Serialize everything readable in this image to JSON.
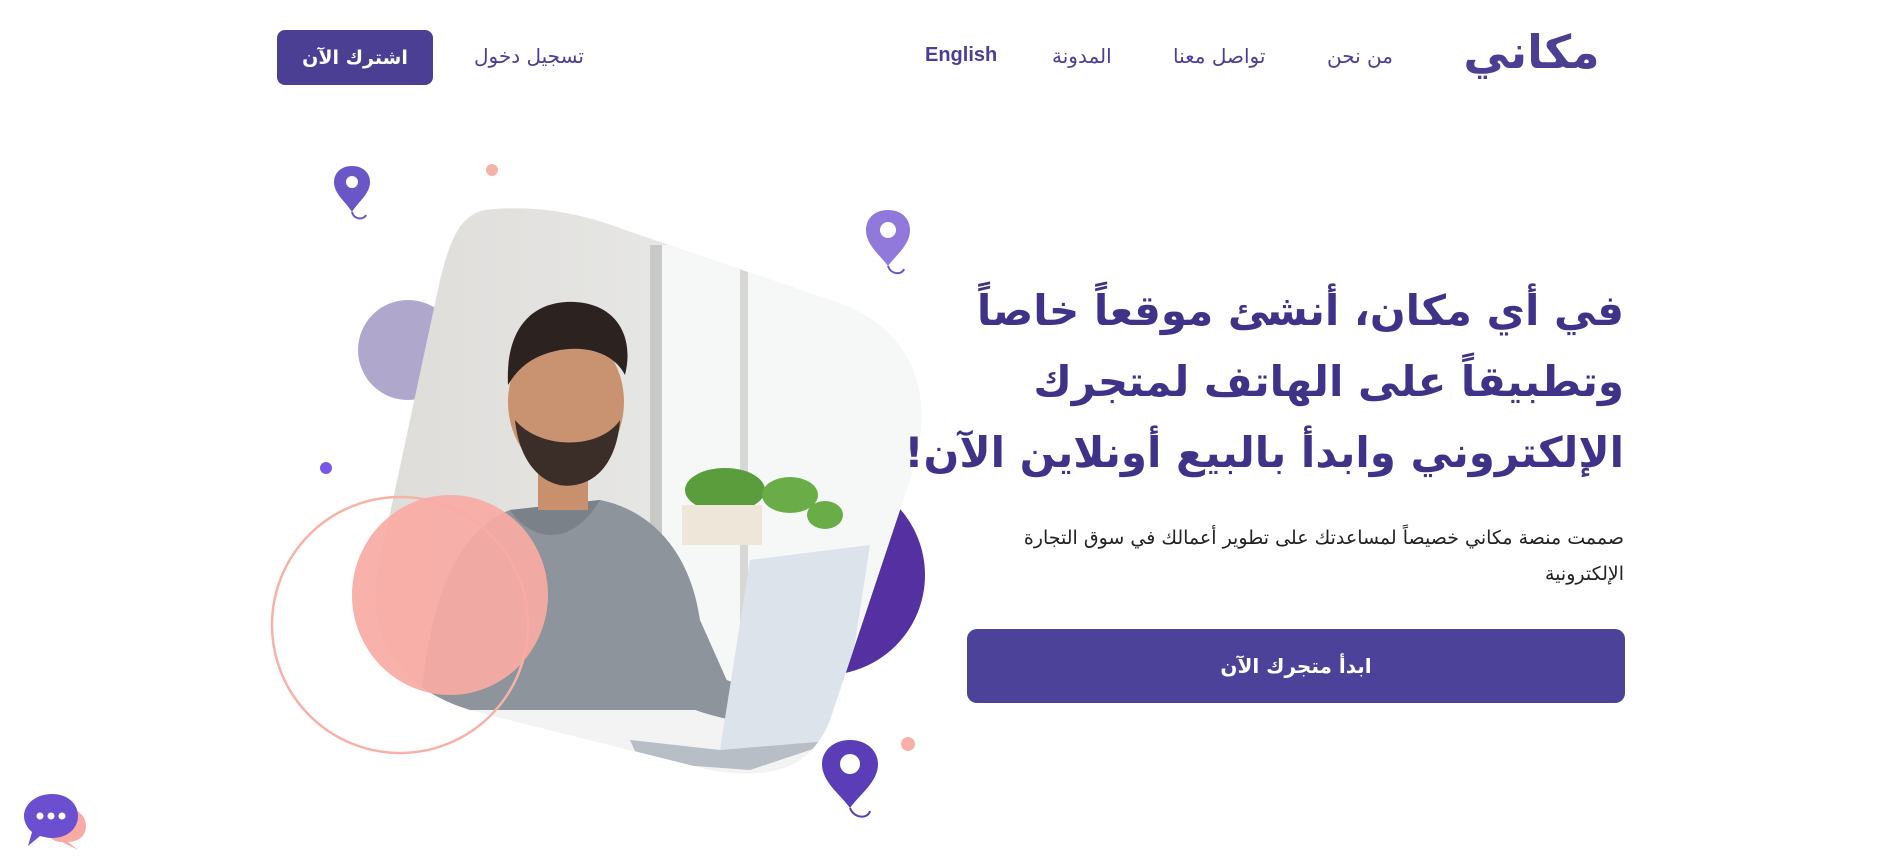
{
  "header": {
    "logo_text": "مكاني",
    "nav": {
      "about": "من نحن",
      "contact": "تواصل معنا",
      "blog": "المدونة",
      "language": "English"
    },
    "login": "تسجيل دخول",
    "signup": "اشترك الآن"
  },
  "hero": {
    "headline_lines": [
      "في أي مكان، أنشئ موقعاً خاصاً",
      "وتطبيقاً على الهاتف لمتجرك",
      "الإلكتروني وابدأ بالبيع أونلاين الآن!"
    ],
    "subtext_lines": [
      "صممت منصة مكاني خصيصاً لمساعدتك على تطوير أعمالك في سوق التجارة",
      "الإلكترونية"
    ],
    "cta": "ابدأ متجرك الآن"
  },
  "colors": {
    "brand": "#4b3f94",
    "accent_pink": "#f8aaa4",
    "accent_lavender": "#b0a7cd",
    "accent_purple": "#5530a0"
  },
  "icons": {
    "chat": "chat-bubble-icon",
    "pin": "map-pin-icon"
  }
}
